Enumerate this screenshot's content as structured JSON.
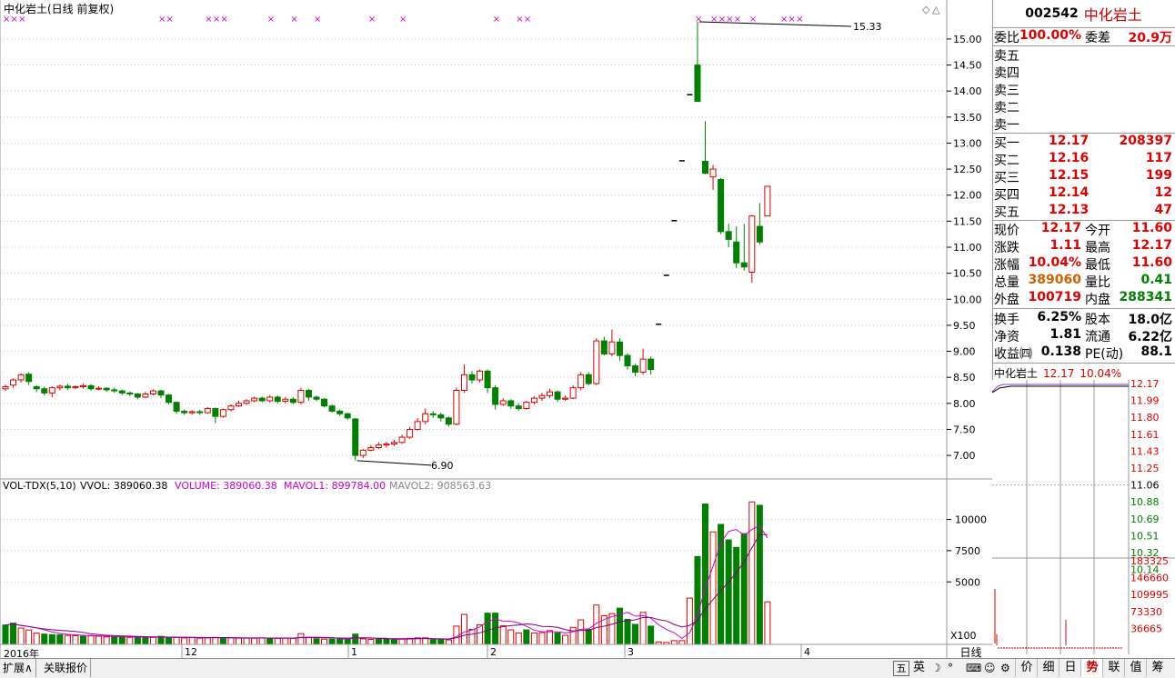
{
  "chart": {
    "title": "中化岩土(日线 前复权)",
    "high_annotation": "15.33",
    "low_annotation": "6.90",
    "y_ticks": [
      "15.00",
      "14.50",
      "14.00",
      "13.50",
      "13.00",
      "12.50",
      "12.00",
      "11.50",
      "11.00",
      "10.50",
      "10.00",
      "9.50",
      "9.00",
      "8.50",
      "8.00",
      "7.50",
      "7.00"
    ],
    "volume_header": {
      "name": "VOL-TDX(5,10)",
      "vvol": "VVOL: 389060.38",
      "volume": "VOLUME: 389060.38",
      "mavol1": "MAVOL1: 899784.00",
      "mavol2": "MAVOL2: 908563.63"
    },
    "volume_ticks": [
      "10000",
      "7500",
      "5000"
    ],
    "volume_unit": "X100",
    "period_label": "日线",
    "time_labels": [
      "2016年",
      "12",
      "1",
      "2",
      "3",
      "4"
    ],
    "colors": {
      "up": "#e00000",
      "down": "#008000",
      "ma_magenta": "#cc00cc",
      "ma_purple": "#800080",
      "mark": "#cc00cc",
      "grid": "#c8c8c8",
      "axis": "#999999"
    }
  },
  "chart_data": {
    "type": "candlestick",
    "price_range": [
      6.6,
      15.4
    ],
    "volume_range": [
      0,
      12000
    ],
    "candles": [
      [
        8.28,
        8.32,
        8.36,
        8.24
      ],
      [
        8.35,
        8.45,
        8.48,
        8.3
      ],
      [
        8.45,
        8.55,
        8.58,
        8.4
      ],
      [
        8.56,
        8.42,
        8.6,
        8.35
      ],
      [
        8.32,
        8.28,
        8.35,
        8.22
      ],
      [
        8.28,
        8.2,
        8.32,
        8.15
      ],
      [
        8.2,
        8.3,
        8.33,
        8.12
      ],
      [
        8.3,
        8.33,
        8.36,
        8.25
      ],
      [
        8.33,
        8.3,
        8.38,
        8.26
      ],
      [
        8.3,
        8.32,
        8.35,
        8.27
      ],
      [
        8.32,
        8.34,
        8.38,
        8.28
      ],
      [
        8.34,
        8.28,
        8.37,
        8.24
      ],
      [
        8.28,
        8.29,
        8.33,
        8.25
      ],
      [
        8.29,
        8.26,
        8.31,
        8.22
      ],
      [
        8.26,
        8.24,
        8.3,
        8.2
      ],
      [
        8.24,
        8.2,
        8.27,
        8.16
      ],
      [
        8.2,
        8.18,
        8.23,
        8.14
      ],
      [
        8.18,
        8.12,
        8.2,
        8.08
      ],
      [
        8.12,
        8.18,
        8.22,
        8.1
      ],
      [
        8.18,
        8.24,
        8.27,
        8.15
      ],
      [
        8.24,
        8.16,
        8.26,
        8.1
      ],
      [
        8.16,
        8.02,
        8.18,
        7.98
      ],
      [
        8.02,
        7.85,
        8.03,
        7.8
      ],
      [
        7.85,
        7.82,
        7.88,
        7.78
      ],
      [
        7.82,
        7.84,
        7.87,
        7.78
      ],
      [
        7.84,
        7.82,
        7.88,
        7.78
      ],
      [
        7.82,
        7.9,
        7.93,
        7.8
      ],
      [
        7.9,
        7.75,
        7.92,
        7.62
      ],
      [
        7.75,
        7.88,
        7.9,
        7.72
      ],
      [
        7.88,
        7.95,
        7.98,
        7.85
      ],
      [
        7.95,
        8.0,
        8.05,
        7.93
      ],
      [
        8.0,
        8.05,
        8.08,
        7.97
      ],
      [
        8.05,
        8.1,
        8.13,
        8.02
      ],
      [
        8.1,
        8.05,
        8.13,
        8.02
      ],
      [
        8.05,
        8.12,
        8.16,
        8.02
      ],
      [
        8.12,
        8.04,
        8.15,
        8.0
      ],
      [
        8.04,
        8.08,
        8.12,
        8.0
      ],
      [
        8.08,
        8.02,
        8.12,
        7.98
      ],
      [
        8.02,
        8.25,
        8.3,
        7.98
      ],
      [
        8.25,
        8.12,
        8.28,
        8.05
      ],
      [
        8.12,
        8.08,
        8.15,
        8.04
      ],
      [
        8.08,
        7.95,
        8.1,
        7.92
      ],
      [
        7.95,
        7.85,
        7.98,
        7.82
      ],
      [
        7.85,
        7.8,
        7.88,
        7.76
      ],
      [
        7.8,
        7.72,
        7.82,
        7.68
      ],
      [
        7.7,
        7.0,
        7.72,
        6.9
      ],
      [
        7.0,
        7.1,
        7.12,
        6.95
      ],
      [
        7.1,
        7.15,
        7.2,
        7.08
      ],
      [
        7.15,
        7.2,
        7.25,
        7.12
      ],
      [
        7.2,
        7.22,
        7.26,
        7.15
      ],
      [
        7.22,
        7.25,
        7.3,
        7.18
      ],
      [
        7.25,
        7.35,
        7.4,
        7.22
      ],
      [
        7.35,
        7.5,
        7.55,
        7.32
      ],
      [
        7.5,
        7.65,
        7.72,
        7.48
      ],
      [
        7.65,
        7.8,
        7.9,
        7.6
      ],
      [
        7.8,
        7.78,
        7.85,
        7.72
      ],
      [
        7.78,
        7.72,
        7.82,
        7.65
      ],
      [
        7.72,
        7.6,
        7.75,
        7.55
      ],
      [
        7.6,
        8.25,
        8.3,
        7.58
      ],
      [
        8.25,
        8.55,
        8.75,
        8.2
      ],
      [
        8.55,
        8.45,
        8.62,
        8.38
      ],
      [
        8.45,
        8.62,
        8.65,
        8.4
      ],
      [
        8.62,
        8.3,
        8.65,
        8.2
      ],
      [
        8.3,
        7.98,
        8.35,
        7.88
      ],
      [
        7.98,
        8.05,
        8.1,
        7.95
      ],
      [
        8.05,
        7.95,
        8.08,
        7.9
      ],
      [
        7.95,
        7.9,
        8.0,
        7.86
      ],
      [
        7.9,
        8.02,
        8.05,
        7.88
      ],
      [
        8.02,
        8.1,
        8.14,
        7.98
      ],
      [
        8.1,
        8.15,
        8.2,
        8.05
      ],
      [
        8.15,
        8.22,
        8.28,
        8.1
      ],
      [
        8.22,
        8.08,
        8.25,
        8.03
      ],
      [
        8.08,
        8.1,
        8.15,
        8.05
      ],
      [
        8.1,
        8.3,
        8.35,
        8.08
      ],
      [
        8.3,
        8.55,
        8.6,
        8.25
      ],
      [
        8.55,
        8.38,
        8.6,
        8.35
      ],
      [
        8.38,
        9.2,
        9.25,
        8.35
      ],
      [
        9.2,
        8.95,
        9.28,
        8.92
      ],
      [
        8.95,
        9.18,
        9.42,
        8.9
      ],
      [
        9.18,
        8.92,
        9.25,
        8.82
      ],
      [
        8.92,
        8.72,
        8.96,
        8.65
      ],
      [
        8.72,
        8.6,
        8.76,
        8.52
      ],
      [
        8.6,
        8.85,
        9.05,
        8.55
      ],
      [
        8.85,
        8.65,
        8.9,
        8.55
      ],
      [
        9.52,
        9.52,
        9.52,
        9.52
      ],
      [
        10.46,
        10.46,
        10.46,
        10.46
      ],
      [
        11.51,
        11.51,
        11.51,
        11.51
      ],
      [
        12.66,
        12.66,
        12.66,
        12.66
      ],
      [
        13.93,
        13.93,
        13.93,
        13.93
      ],
      [
        14.5,
        13.8,
        15.33,
        13.8
      ],
      [
        12.65,
        12.42,
        13.42,
        12.4
      ],
      [
        12.35,
        12.5,
        12.58,
        12.1
      ],
      [
        12.3,
        11.3,
        12.33,
        11.25
      ],
      [
        11.3,
        11.15,
        11.45,
        11.0
      ],
      [
        11.1,
        10.7,
        11.4,
        10.6
      ],
      [
        10.7,
        10.62,
        11.45,
        10.55
      ],
      [
        10.52,
        11.6,
        11.62,
        10.32
      ],
      [
        11.4,
        11.1,
        11.85,
        11.05
      ],
      [
        11.6,
        12.17,
        12.17,
        11.6
      ]
    ],
    "volumes": [
      [
        1550,
        "down"
      ],
      [
        1700,
        "down"
      ],
      [
        1300,
        "up"
      ],
      [
        1150,
        "up"
      ],
      [
        900,
        "up"
      ],
      [
        820,
        "down"
      ],
      [
        780,
        "down"
      ],
      [
        780,
        "down"
      ],
      [
        720,
        "up"
      ],
      [
        700,
        "up"
      ],
      [
        650,
        "down"
      ],
      [
        680,
        "up"
      ],
      [
        650,
        "up"
      ],
      [
        600,
        "up"
      ],
      [
        580,
        "down"
      ],
      [
        620,
        "down"
      ],
      [
        560,
        "up"
      ],
      [
        560,
        "down"
      ],
      [
        560,
        "down"
      ],
      [
        560,
        "up"
      ],
      [
        640,
        "down"
      ],
      [
        520,
        "down"
      ],
      [
        560,
        "up"
      ],
      [
        520,
        "up"
      ],
      [
        540,
        "up"
      ],
      [
        500,
        "up"
      ],
      [
        520,
        "up"
      ],
      [
        560,
        "up"
      ],
      [
        500,
        "down"
      ],
      [
        520,
        "up"
      ],
      [
        500,
        "up"
      ],
      [
        500,
        "up"
      ],
      [
        500,
        "up"
      ],
      [
        520,
        "up"
      ],
      [
        480,
        "down"
      ],
      [
        480,
        "up"
      ],
      [
        500,
        "up"
      ],
      [
        480,
        "up"
      ],
      [
        860,
        "up"
      ],
      [
        560,
        "up"
      ],
      [
        450,
        "down"
      ],
      [
        420,
        "up"
      ],
      [
        420,
        "down"
      ],
      [
        420,
        "down"
      ],
      [
        420,
        "down"
      ],
      [
        820,
        "down"
      ],
      [
        440,
        "up"
      ],
      [
        400,
        "up"
      ],
      [
        400,
        "down"
      ],
      [
        400,
        "down"
      ],
      [
        400,
        "down"
      ],
      [
        440,
        "up"
      ],
      [
        480,
        "up"
      ],
      [
        520,
        "up"
      ],
      [
        520,
        "up"
      ],
      [
        360,
        "down"
      ],
      [
        360,
        "down"
      ],
      [
        360,
        "up"
      ],
      [
        1460,
        "up"
      ],
      [
        2400,
        "up"
      ],
      [
        1200,
        "up"
      ],
      [
        1560,
        "up"
      ],
      [
        2500,
        "down"
      ],
      [
        2500,
        "down"
      ],
      [
        1500,
        "up"
      ],
      [
        1160,
        "up"
      ],
      [
        920,
        "up"
      ],
      [
        1160,
        "down"
      ],
      [
        920,
        "up"
      ],
      [
        940,
        "up"
      ],
      [
        1100,
        "up"
      ],
      [
        920,
        "down"
      ],
      [
        720,
        "up"
      ],
      [
        1360,
        "up"
      ],
      [
        1960,
        "up"
      ],
      [
        1200,
        "down"
      ],
      [
        3150,
        "up"
      ],
      [
        2300,
        "up"
      ],
      [
        2460,
        "up"
      ],
      [
        2900,
        "down"
      ],
      [
        2000,
        "down"
      ],
      [
        1600,
        "down"
      ],
      [
        2560,
        "up"
      ],
      [
        1460,
        "down"
      ],
      [
        200,
        "up"
      ],
      [
        150,
        "up"
      ],
      [
        300,
        "up"
      ],
      [
        300,
        "up"
      ],
      [
        3700,
        "up"
      ],
      [
        7030,
        "down"
      ],
      [
        11230,
        "down"
      ],
      [
        9000,
        "up"
      ],
      [
        9600,
        "down"
      ],
      [
        8360,
        "down"
      ],
      [
        7760,
        "down"
      ],
      [
        8860,
        "down"
      ],
      [
        11400,
        "up"
      ],
      [
        11130,
        "down"
      ],
      [
        3400,
        "up"
      ]
    ],
    "top_markers": [
      0,
      1,
      2,
      20,
      21,
      26,
      27,
      28,
      34,
      37,
      40,
      47,
      51,
      63,
      66,
      67,
      89,
      91,
      92,
      93,
      94,
      96,
      100,
      101,
      102
    ]
  },
  "quote": {
    "code": "002542",
    "name": "中化岩土",
    "weibi_label": "委比",
    "weibi": "100.00%",
    "weicha_label": "委差",
    "weicha": "20.9万",
    "sell": [
      {
        "label": "卖五"
      },
      {
        "label": "卖四"
      },
      {
        "label": "卖三"
      },
      {
        "label": "卖二"
      },
      {
        "label": "卖一"
      }
    ],
    "buy": [
      {
        "label": "买一",
        "price": "12.17",
        "vol": "208397"
      },
      {
        "label": "买二",
        "price": "12.16",
        "vol": "117"
      },
      {
        "label": "买三",
        "price": "12.15",
        "vol": "199"
      },
      {
        "label": "买四",
        "price": "12.14",
        "vol": "12"
      },
      {
        "label": "买五",
        "price": "12.13",
        "vol": "47"
      }
    ],
    "stats": [
      {
        "l1": "现价",
        "v1": "12.17",
        "c1": "red",
        "l2": "今开",
        "v2": "11.60",
        "c2": "red"
      },
      {
        "l1": "涨跌",
        "v1": "1.11",
        "c1": "red",
        "l2": "最高",
        "v2": "12.17",
        "c2": "red"
      },
      {
        "l1": "涨幅",
        "v1": "10.04%",
        "c1": "red",
        "l2": "最低",
        "v2": "11.60",
        "c2": "red"
      },
      {
        "l1": "总量",
        "v1": "389060",
        "c1": "orange",
        "l2": "量比",
        "v2": "0.41",
        "c2": "green"
      },
      {
        "l1": "外盘",
        "v1": "100719",
        "c1": "red",
        "l2": "内盘",
        "v2": "288341",
        "c2": "green"
      },
      {
        "l1": "换手",
        "v1": "6.25%",
        "c1": "black",
        "l2": "股本",
        "v2": "18.0亿",
        "c2": "black"
      },
      {
        "l1": "净资",
        "v1": "1.81",
        "c1": "black",
        "l2": "流通",
        "v2": "6.22亿",
        "c2": "black"
      },
      {
        "l1": "收益㈣",
        "v1": "0.138",
        "c1": "black",
        "l2": "PE(动)",
        "v2": "88.1",
        "c2": "black"
      }
    ]
  },
  "mini": {
    "name": "中化岩土",
    "price": "12.17",
    "change": "10.04%",
    "price_ticks": [
      "12.17",
      "11.99",
      "11.80",
      "11.61",
      "11.43",
      "11.25",
      "11.06",
      "10.88",
      "10.69",
      "10.51",
      "10.32",
      "10.14"
    ],
    "vol_ticks": [
      "183325",
      "146660",
      "109995",
      "73330",
      "36665"
    ]
  },
  "bottom": {
    "left_tabs": [
      "扩展∧",
      "关联报价"
    ],
    "right_tabs": [
      "价",
      "细",
      "日",
      "势",
      "联",
      "值",
      "筹"
    ],
    "active_tab": "势",
    "ime_char": "英",
    "ime_mark": "五"
  }
}
